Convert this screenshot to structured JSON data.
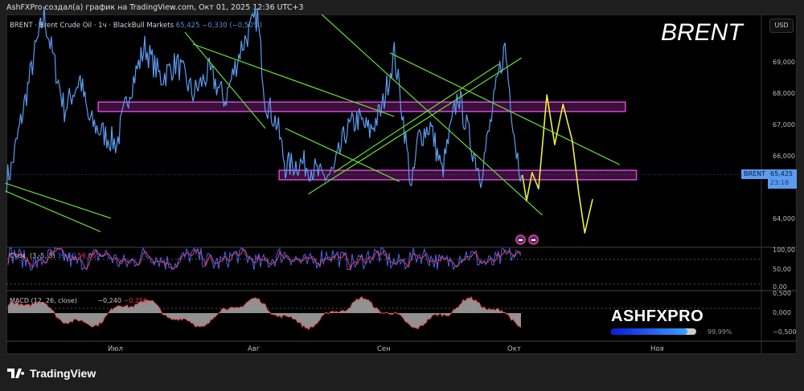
{
  "credit": "AshFXPro создал(а) график на TradingView.com, Окт 01, 2025 12:36 UTC+3",
  "legend": {
    "title": "BRENT · Brent Crude Oil · 1ч · BlackBull Markets",
    "price": "65,425",
    "change": "−0,330 (−0,50%)"
  },
  "watermark": "BRENT",
  "currency": "USD",
  "last_tag": {
    "symbol": "BRENT",
    "price": "65,425",
    "countdown": "23:18"
  },
  "stoch": {
    "label": "Стох. (3, 5, 3)",
    "k": "39,60",
    "d": "56,05",
    "scale": [
      "100,00",
      "50,00",
      "0,00"
    ]
  },
  "macd": {
    "label": "MACD (12, 26, close)",
    "macd": "−0,240",
    "signal": "−0,256",
    "scale": [
      "0,500",
      "0,000",
      "−0,500"
    ]
  },
  "branding": {
    "name": "ASHFXPRO",
    "progress_label": "99.99%",
    "progress": 99.99
  },
  "footer": "TradingView",
  "colors": {
    "price": "#5b9cf0",
    "zone": "#e040e0",
    "trend": "#66dd33",
    "forecast": "#eeee44",
    "stoch_k": "#4466ee",
    "stoch_d": "#e04070",
    "macd_hist": "#aaaaaa"
  },
  "chart_data": {
    "type": "line",
    "title": "BRENT · Brent Crude Oil · 1ч",
    "ylabel": "USD",
    "ylim": [
      63.1,
      70.55
    ],
    "yticks": [
      {
        "v": 69,
        "label": "69,000"
      },
      {
        "v": 68,
        "label": "68,000"
      },
      {
        "v": 67,
        "label": "67,000"
      },
      {
        "v": 66,
        "label": "66,000"
      },
      {
        "v": 64,
        "label": "64,000"
      }
    ],
    "xticks": [
      {
        "day": 0,
        "label": "Июл"
      },
      {
        "day": 31,
        "label": "Авг"
      },
      {
        "day": 62,
        "label": "Сен"
      },
      {
        "day": 92,
        "label": "Окт"
      },
      {
        "day": 123,
        "label": "Ноя"
      }
    ],
    "x_unit": "days since Jul 1",
    "price_series": [
      [
        -24,
        65.3
      ],
      [
        -23,
        65.6
      ],
      [
        -17.5,
        69.5
      ],
      [
        -15.7,
        70.5
      ],
      [
        -11.2,
        67.5
      ],
      [
        -7.7,
        68.5
      ],
      [
        -5.9,
        67.2
      ],
      [
        -3.2,
        66.8
      ],
      [
        0.4,
        66.4
      ],
      [
        3,
        68
      ],
      [
        6.6,
        69.5
      ],
      [
        10.2,
        68.5
      ],
      [
        13.7,
        69
      ],
      [
        17.3,
        68
      ],
      [
        20.9,
        68.7
      ],
      [
        24.4,
        67.8
      ],
      [
        28,
        69.5
      ],
      [
        31.6,
        70.5
      ],
      [
        33.5,
        67.8
      ],
      [
        36.4,
        67
      ],
      [
        38.3,
        65.7
      ],
      [
        42.2,
        65.8
      ],
      [
        45.1,
        65.6
      ],
      [
        47,
        65.3
      ],
      [
        49.9,
        65.5
      ],
      [
        52.8,
        66.8
      ],
      [
        55.7,
        67.2
      ],
      [
        58.5,
        66.8
      ],
      [
        61.4,
        67.5
      ],
      [
        64.3,
        69.3
      ],
      [
        66.1,
        67.5
      ],
      [
        68.3,
        64.9
      ],
      [
        69.8,
        66.6
      ],
      [
        72.6,
        67
      ],
      [
        75.3,
        65.5
      ],
      [
        79,
        68
      ],
      [
        81.8,
        66.5
      ],
      [
        84.2,
        65.4
      ],
      [
        86.4,
        67
      ],
      [
        88.3,
        68.6
      ],
      [
        89.8,
        69.5
      ],
      [
        91.1,
        67.8
      ],
      [
        92.4,
        66.2
      ],
      [
        93.5,
        65.4
      ]
    ],
    "forecast": [
      [
        93.7,
        65.41
      ],
      [
        94.6,
        64.59
      ],
      [
        95.8,
        65.49
      ],
      [
        97.2,
        64.97
      ],
      [
        99,
        67.97
      ],
      [
        100.7,
        66.38
      ],
      [
        102.5,
        67.67
      ],
      [
        104.5,
        66.51
      ],
      [
        105.9,
        64.85
      ],
      [
        107.2,
        63.56
      ],
      [
        108.9,
        64.64
      ]
    ],
    "zones": [
      {
        "from_day": -3.7,
        "to_day": 116,
        "low": 67.44,
        "high": 67.74
      },
      {
        "from_day": 36.8,
        "to_day": 118.4,
        "low": 65.26,
        "high": 65.56
      }
    ],
    "trendlines": [
      [
        [
          -24.3,
          65.15
        ],
        [
          -0.9,
          64.03
        ]
      ],
      [
        [
          -24.3,
          64.9
        ],
        [
          -3.2,
          63.6
        ]
      ],
      [
        [
          15.5,
          69.97
        ],
        [
          33.5,
          66.9
        ]
      ],
      [
        [
          17.3,
          69.59
        ],
        [
          64.3,
          67.28
        ]
      ],
      [
        [
          38.3,
          66.9
        ],
        [
          65.5,
          65.2
        ]
      ],
      [
        [
          47,
          70.54
        ],
        [
          98,
          64.13
        ]
      ],
      [
        [
          43.8,
          64.8
        ],
        [
          93.5,
          69.15
        ]
      ],
      [
        [
          49.9,
          65.49
        ],
        [
          88.3,
          68.95
        ]
      ],
      [
        [
          63.3,
          69.31
        ],
        [
          114.8,
          65.74
        ]
      ]
    ],
    "last_price": 65.425
  }
}
